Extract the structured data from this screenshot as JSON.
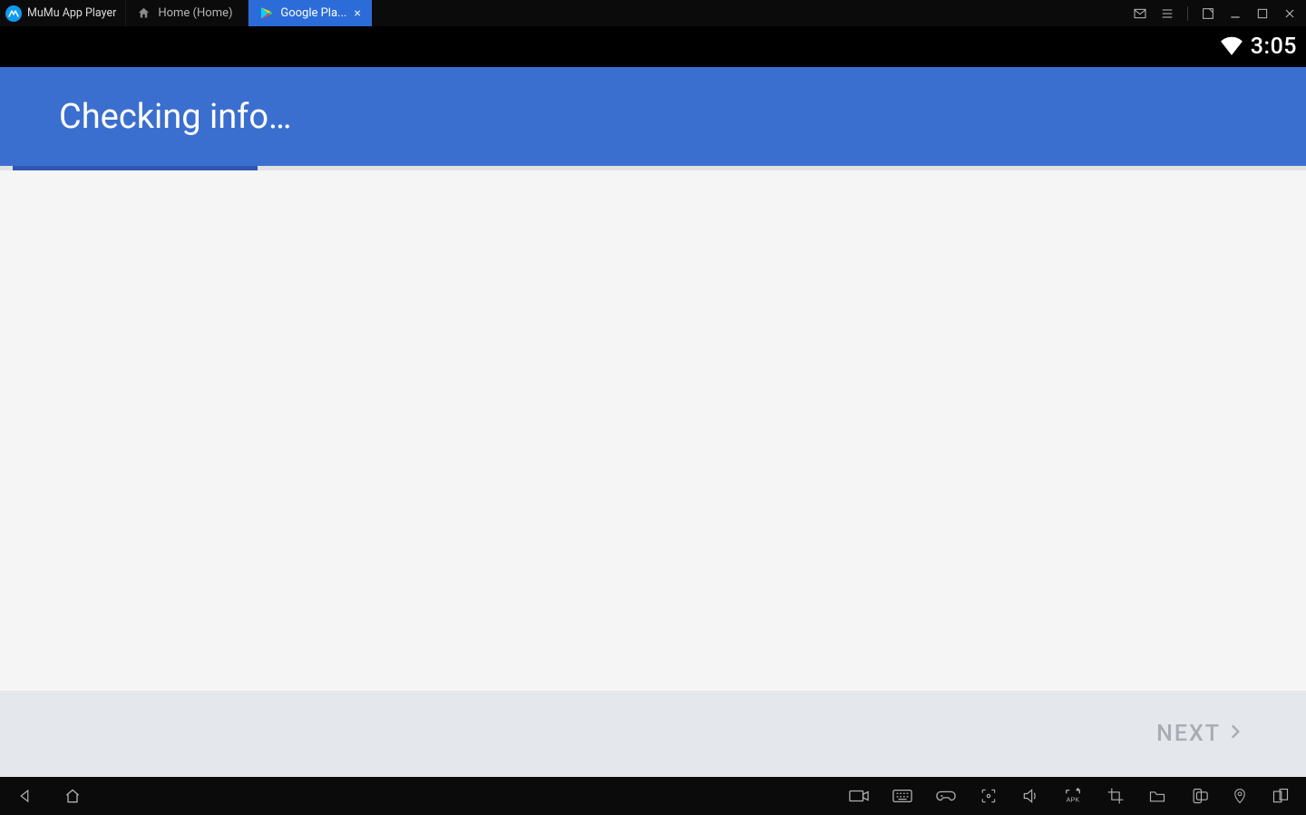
{
  "brand": {
    "name": "MuMu App Player"
  },
  "tabs": [
    {
      "label": "Home (Home)",
      "icon": "home-icon",
      "active": false
    },
    {
      "label": "Google Pla...",
      "icon": "play-icon",
      "active": true
    }
  ],
  "status_bar": {
    "time": "3:05"
  },
  "screen": {
    "title": "Checking info…",
    "footer_button": "NEXT"
  }
}
